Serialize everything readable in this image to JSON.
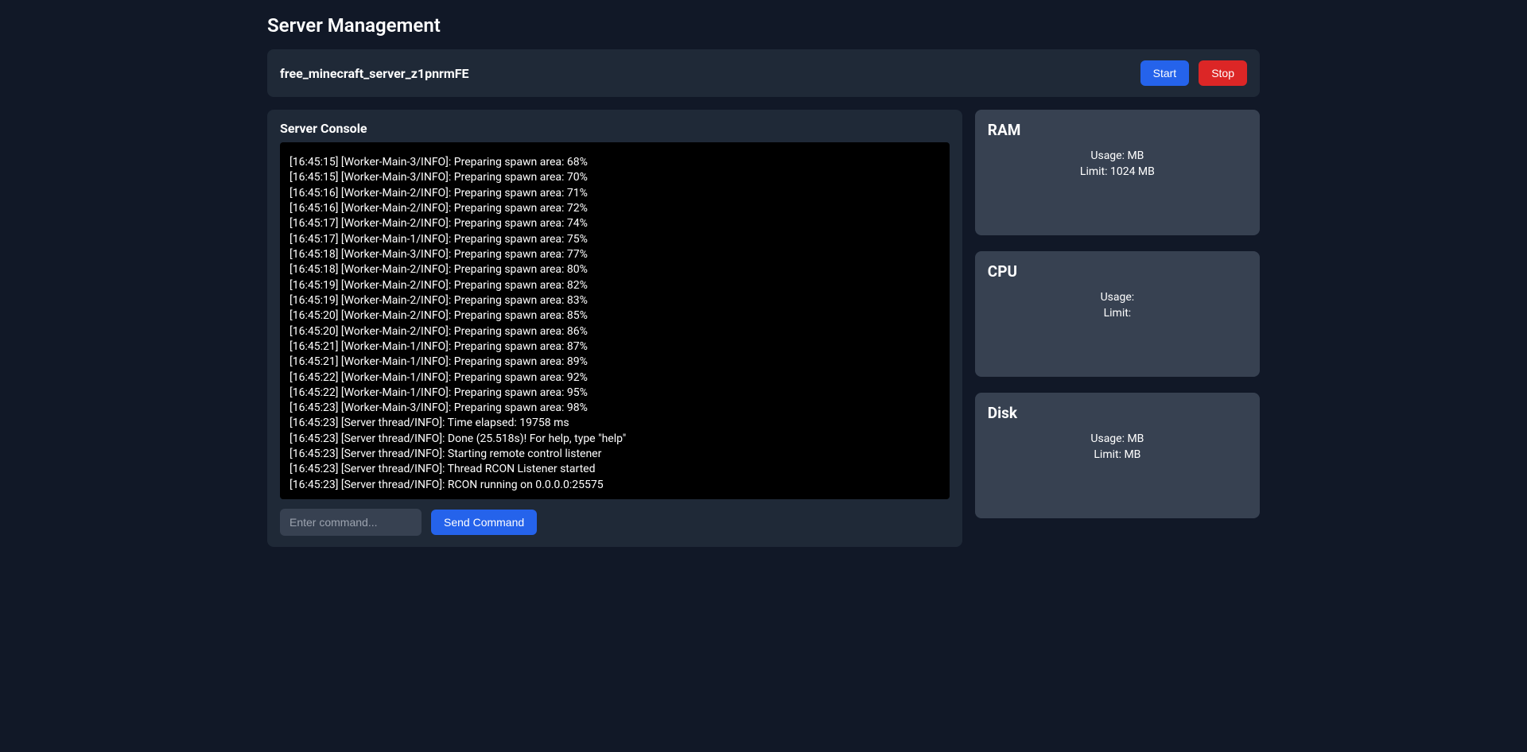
{
  "page_title": "Server Management",
  "server_name": "free_minecraft_server_z1pnrmFE",
  "buttons": {
    "start": "Start",
    "stop": "Stop",
    "send": "Send Command"
  },
  "console": {
    "title": "Server Console",
    "placeholder": "Enter command...",
    "lines": [
      "[16:45:15] [Worker-Main-3/INFO]: Preparing spawn area: 68%",
      "[16:45:15] [Worker-Main-3/INFO]: Preparing spawn area: 70%",
      "[16:45:16] [Worker-Main-2/INFO]: Preparing spawn area: 71%",
      "[16:45:16] [Worker-Main-2/INFO]: Preparing spawn area: 72%",
      "[16:45:17] [Worker-Main-2/INFO]: Preparing spawn area: 74%",
      "[16:45:17] [Worker-Main-1/INFO]: Preparing spawn area: 75%",
      "[16:45:18] [Worker-Main-3/INFO]: Preparing spawn area: 77%",
      "[16:45:18] [Worker-Main-2/INFO]: Preparing spawn area: 80%",
      "[16:45:19] [Worker-Main-2/INFO]: Preparing spawn area: 82%",
      "[16:45:19] [Worker-Main-2/INFO]: Preparing spawn area: 83%",
      "[16:45:20] [Worker-Main-2/INFO]: Preparing spawn area: 85%",
      "[16:45:20] [Worker-Main-2/INFO]: Preparing spawn area: 86%",
      "[16:45:21] [Worker-Main-1/INFO]: Preparing spawn area: 87%",
      "[16:45:21] [Worker-Main-1/INFO]: Preparing spawn area: 89%",
      "[16:45:22] [Worker-Main-1/INFO]: Preparing spawn area: 92%",
      "[16:45:22] [Worker-Main-1/INFO]: Preparing spawn area: 95%",
      "[16:45:23] [Worker-Main-3/INFO]: Preparing spawn area: 98%",
      "[16:45:23] [Server thread/INFO]: Time elapsed: 19758 ms",
      "[16:45:23] [Server thread/INFO]: Done (25.518s)! For help, type \"help\"",
      "[16:45:23] [Server thread/INFO]: Starting remote control listener",
      "[16:45:23] [Server thread/INFO]: Thread RCON Listener started",
      "[16:45:23] [Server thread/INFO]: RCON running on 0.0.0.0:25575"
    ]
  },
  "stats": {
    "ram": {
      "title": "RAM",
      "usage": "Usage:  MB",
      "limit": "Limit: 1024 MB"
    },
    "cpu": {
      "title": "CPU",
      "usage": "Usage:",
      "limit": "Limit:"
    },
    "disk": {
      "title": "Disk",
      "usage": "Usage:  MB",
      "limit": "Limit:  MB"
    }
  }
}
